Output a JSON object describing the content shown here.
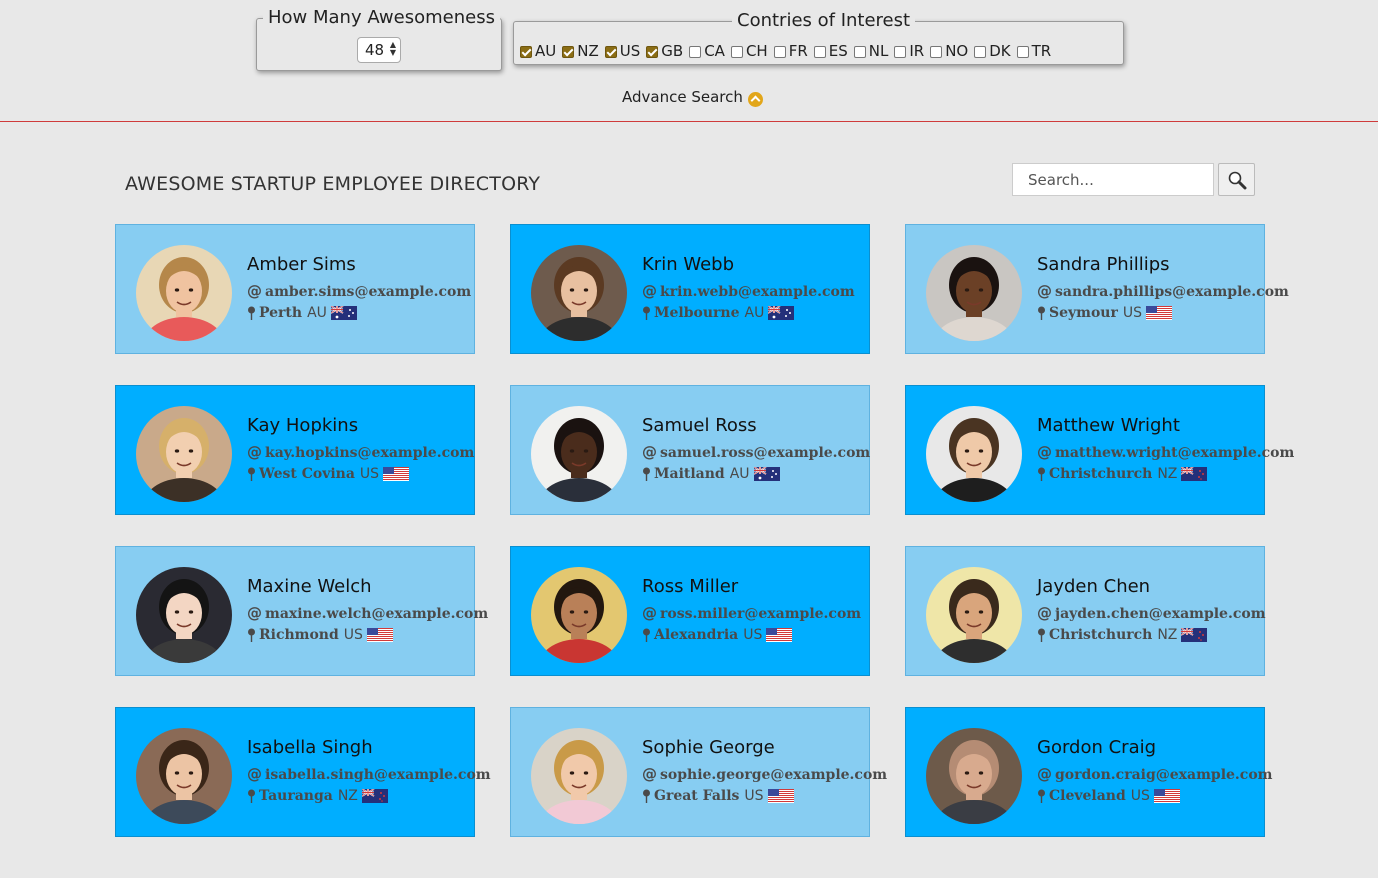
{
  "controls": {
    "how_many_legend": "How Many Awesomeness",
    "how_many_value": "48",
    "countries_legend": "Contries of Interest",
    "countries": [
      {
        "code": "AU",
        "checked": true
      },
      {
        "code": "NZ",
        "checked": true
      },
      {
        "code": "US",
        "checked": true
      },
      {
        "code": "GB",
        "checked": true
      },
      {
        "code": "CA",
        "checked": false
      },
      {
        "code": "CH",
        "checked": false
      },
      {
        "code": "FR",
        "checked": false
      },
      {
        "code": "ES",
        "checked": false
      },
      {
        "code": "NL",
        "checked": false
      },
      {
        "code": "IR",
        "checked": false
      },
      {
        "code": "NO",
        "checked": false
      },
      {
        "code": "DK",
        "checked": false
      },
      {
        "code": "TR",
        "checked": false
      }
    ],
    "advance_search": "Advance Search",
    "advance_icon": "chevron-up-icon"
  },
  "directory": {
    "title": "AWESOME STARTUP EMPLOYEE DIRECTORY",
    "search_placeholder": "Search...",
    "search_icon": "magnifier-icon",
    "employees": [
      {
        "name": "Amber Sims",
        "email": "amber.sims@example.com",
        "city": "Perth",
        "country": "AU",
        "style": "light",
        "skin": "#f0c3a0",
        "hair": "#b5874a",
        "bg": "#e8d7b5",
        "shirt": "#e85a5a"
      },
      {
        "name": "Krin Webb",
        "email": "krin.webb@example.com",
        "city": "Melbourne",
        "country": "AU",
        "style": "dark",
        "skin": "#e8c0a0",
        "hair": "#5b3a22",
        "bg": "#6e5b4d",
        "shirt": "#2d2d2d"
      },
      {
        "name": "Sandra Phillips",
        "email": "sandra.phillips@example.com",
        "city": "Seymour",
        "country": "US",
        "style": "light",
        "skin": "#6b4026",
        "hair": "#1a1210",
        "bg": "#c9c6c2",
        "shirt": "#ded7d0"
      },
      {
        "name": "Kay Hopkins",
        "email": "kay.hopkins@example.com",
        "city": "West Covina",
        "country": "US",
        "style": "dark",
        "skin": "#f2cfb0",
        "hair": "#d6b06a",
        "bg": "#c9a98a",
        "shirt": "#3c3026"
      },
      {
        "name": "Samuel Ross",
        "email": "samuel.ross@example.com",
        "city": "Maitland",
        "country": "AU",
        "style": "light",
        "skin": "#4a2c1c",
        "hair": "#1a1210",
        "bg": "#f1f1ef",
        "shirt": "#2a2f3a"
      },
      {
        "name": "Matthew Wright",
        "email": "matthew.wright@example.com",
        "city": "Christchurch",
        "country": "NZ",
        "style": "dark",
        "skin": "#efc9a8",
        "hair": "#4a3422",
        "bg": "#e8e8e8",
        "shirt": "#1e1e1e"
      },
      {
        "name": "Maxine Welch",
        "email": "maxine.welch@example.com",
        "city": "Richmond",
        "country": "US",
        "style": "light",
        "skin": "#f3d6c3",
        "hair": "#141414",
        "bg": "#2a2a32",
        "shirt": "#3a3a3a"
      },
      {
        "name": "Ross Miller",
        "email": "ross.miller@example.com",
        "city": "Alexandria",
        "country": "US",
        "style": "dark",
        "skin": "#b98058",
        "hair": "#22170f",
        "bg": "#e3c770",
        "shirt": "#c93632"
      },
      {
        "name": "Jayden Chen",
        "email": "jayden.chen@example.com",
        "city": "Christchurch",
        "country": "NZ",
        "style": "light",
        "skin": "#d9a57c",
        "hair": "#3a2a1c",
        "bg": "#efe6a8",
        "shirt": "#2e2e2e"
      },
      {
        "name": "Isabella Singh",
        "email": "isabella.singh@example.com",
        "city": "Tauranga",
        "country": "NZ",
        "style": "dark",
        "skin": "#ecc4a4",
        "hair": "#3a2618",
        "bg": "#8a6a56",
        "shirt": "#3d4a5a"
      },
      {
        "name": "Sophie George",
        "email": "sophie.george@example.com",
        "city": "Great Falls",
        "country": "US",
        "style": "light",
        "skin": "#f1c9aa",
        "hair": "#c99a48",
        "bg": "#d9d3c8",
        "shirt": "#f2c9d5"
      },
      {
        "name": "Gordon Craig",
        "email": "gordon.craig@example.com",
        "city": "Cleveland",
        "country": "US",
        "style": "dark",
        "skin": "#d8aa8e",
        "hair": "#b58c74",
        "bg": "#6d5a4a",
        "shirt": "#3a3d44"
      }
    ]
  }
}
